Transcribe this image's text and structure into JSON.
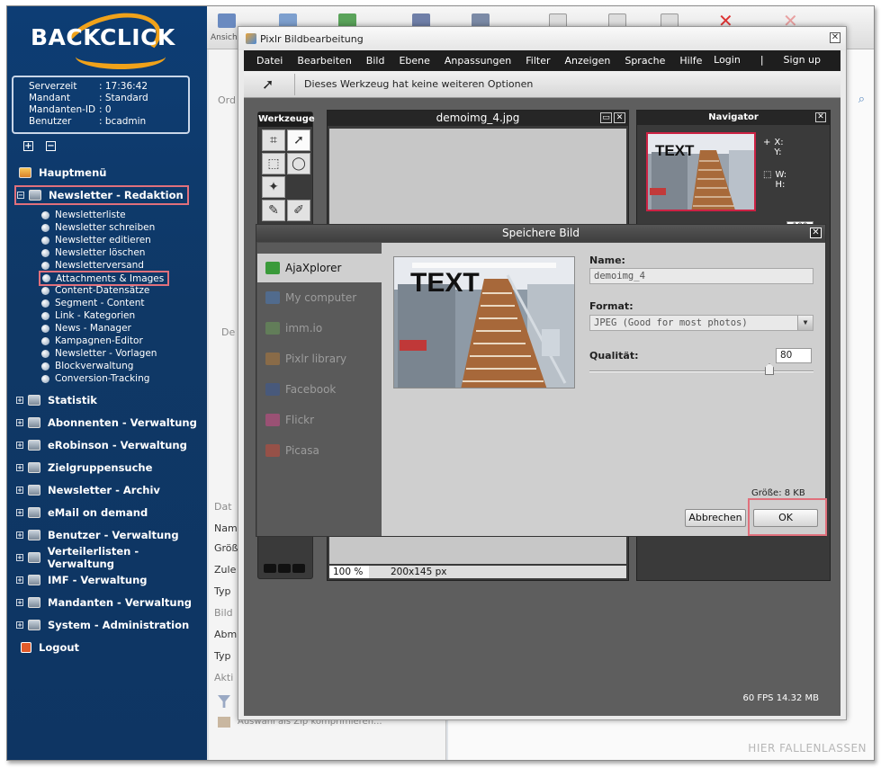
{
  "sidebar": {
    "logo": "BACKCLICK",
    "server_info": [
      {
        "key": "Serverzeit",
        "value": ": 17:36:42"
      },
      {
        "key": "Mandant",
        "value": ": Standard"
      },
      {
        "key": "Mandanten-ID",
        "value": ": 0"
      },
      {
        "key": "Benutzer",
        "value": ": bcadmin"
      }
    ],
    "expand_all": "+",
    "collapse_all": "−",
    "main_menu": "Hauptmenü",
    "newsletter_redaktion": "Newsletter - Redaktion",
    "sub_items": [
      "Newsletterliste",
      "Newsletter schreiben",
      "Newsletter editieren",
      "Newsletter löschen",
      "Newsletterversand",
      "Attachments & Images",
      "Content-Datensätze",
      "Segment - Content",
      "Link - Kategorien",
      "News - Manager",
      "Kampagnen-Editor",
      "Newsletter - Vorlagen",
      "Blockverwaltung",
      "Conversion-Tracking"
    ],
    "sections": [
      "Statistik",
      "Abonnenten - Verwaltung",
      "eRobinson - Verwaltung",
      "Zielgruppensuche",
      "Newsletter - Archiv",
      "eMail on demand",
      "Benutzer - Verwaltung",
      "Verteilerlisten - Verwaltung",
      "IMF - Verwaltung",
      "Mandanten - Verwaltung",
      "System - Administration"
    ],
    "logout": "Logout"
  },
  "background": {
    "toolbar_label": "Ansich",
    "left_labels": [
      "Ord",
      "De",
      "Dat",
      "Nam",
      "Größ",
      "Zule",
      "Typ",
      "Bild",
      "Abm",
      "Typ",
      "Akti"
    ],
    "zip_label": "Auswahl als Zip komprimieren...",
    "dropzone": "HIER FALLENLASSEN"
  },
  "pixlr": {
    "title": "Pixlr Bildbearbeitung",
    "menu": [
      "Datei",
      "Bearbeiten",
      "Bild",
      "Ebene",
      "Anpassungen",
      "Filter",
      "Anzeigen",
      "Sprache",
      "Hilfe"
    ],
    "login": "Login",
    "divider": "|",
    "signup": "Sign up",
    "options_text": "Dieses Werkzeug hat keine weiteren Optionen",
    "toolbox_title": "Werkzeuge",
    "image_window": {
      "title": "demoimg_4.jpg",
      "zoom": "100 %",
      "dimensions": "200x145 px"
    },
    "navigator": {
      "title": "Navigator",
      "x_label": "X:",
      "y_label": "Y:",
      "w_label": "W:",
      "h_label": "H:",
      "zoom_value": "100"
    },
    "status": "60 FPS 14.32 MB"
  },
  "save_dialog": {
    "title": "Speichere Bild",
    "locations": [
      {
        "label": "AjaXplorer",
        "icon": "back-arrow-icon",
        "color": "#3a9a3a"
      },
      {
        "label": "My computer",
        "icon": "monitor-icon",
        "color": "#4a7ab8"
      },
      {
        "label": "imm.io",
        "icon": "image-icon",
        "color": "#6a9a5a"
      },
      {
        "label": "Pixlr library",
        "icon": "library-icon",
        "color": "#b07a3a"
      },
      {
        "label": "Facebook",
        "icon": "facebook-icon",
        "color": "#3b5998"
      },
      {
        "label": "Flickr",
        "icon": "flickr-icon",
        "color": "#d04a8a"
      },
      {
        "label": "Picasa",
        "icon": "picasa-icon",
        "color": "#c84a3a"
      }
    ],
    "preview_text": "TEXT",
    "name_label": "Name:",
    "name_value": "demoimg_4",
    "format_label": "Format:",
    "format_value": "JPEG (Good for most photos)",
    "quality_label": "Qualität:",
    "quality_value": "80",
    "size_label": "Größe: 8 KB",
    "cancel": "Abbrechen",
    "ok": "OK"
  },
  "colors": {
    "sidebar_bg": "#0f3866",
    "highlight": "#e0707c",
    "logo_accent": "#f0a21a"
  }
}
